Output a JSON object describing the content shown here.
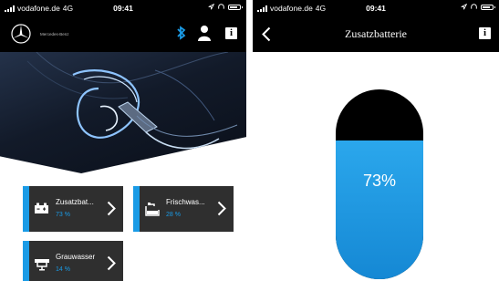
{
  "status_bar": {
    "carrier": "vodafone.de",
    "network": "4G",
    "time": "09:41"
  },
  "dashboard": {
    "brand": "Mercedes-Benz",
    "icons": [
      "mercedes-star-icon",
      "bluetooth-icon",
      "user-icon",
      "info-icon"
    ],
    "hero_image": "ev-charging-illustration",
    "tiles": [
      {
        "name": "Zusatzbat...",
        "percent": "73 %",
        "icon": "battery-icon"
      },
      {
        "name": "Frischwas...",
        "percent": "28 %",
        "icon": "freshwater-tank-icon"
      },
      {
        "name": "Grauwasser",
        "percent": "14 %",
        "icon": "greywater-tank-icon"
      }
    ]
  },
  "detail": {
    "title": "Zusatzbatterie",
    "level_label": "73%",
    "level_fraction": 0.73,
    "icons": [
      "back-chevron-icon",
      "info-icon"
    ]
  },
  "colors": {
    "accent": "#1a9be6",
    "header": "#000000",
    "tile_bg": "#2f2f2f"
  }
}
